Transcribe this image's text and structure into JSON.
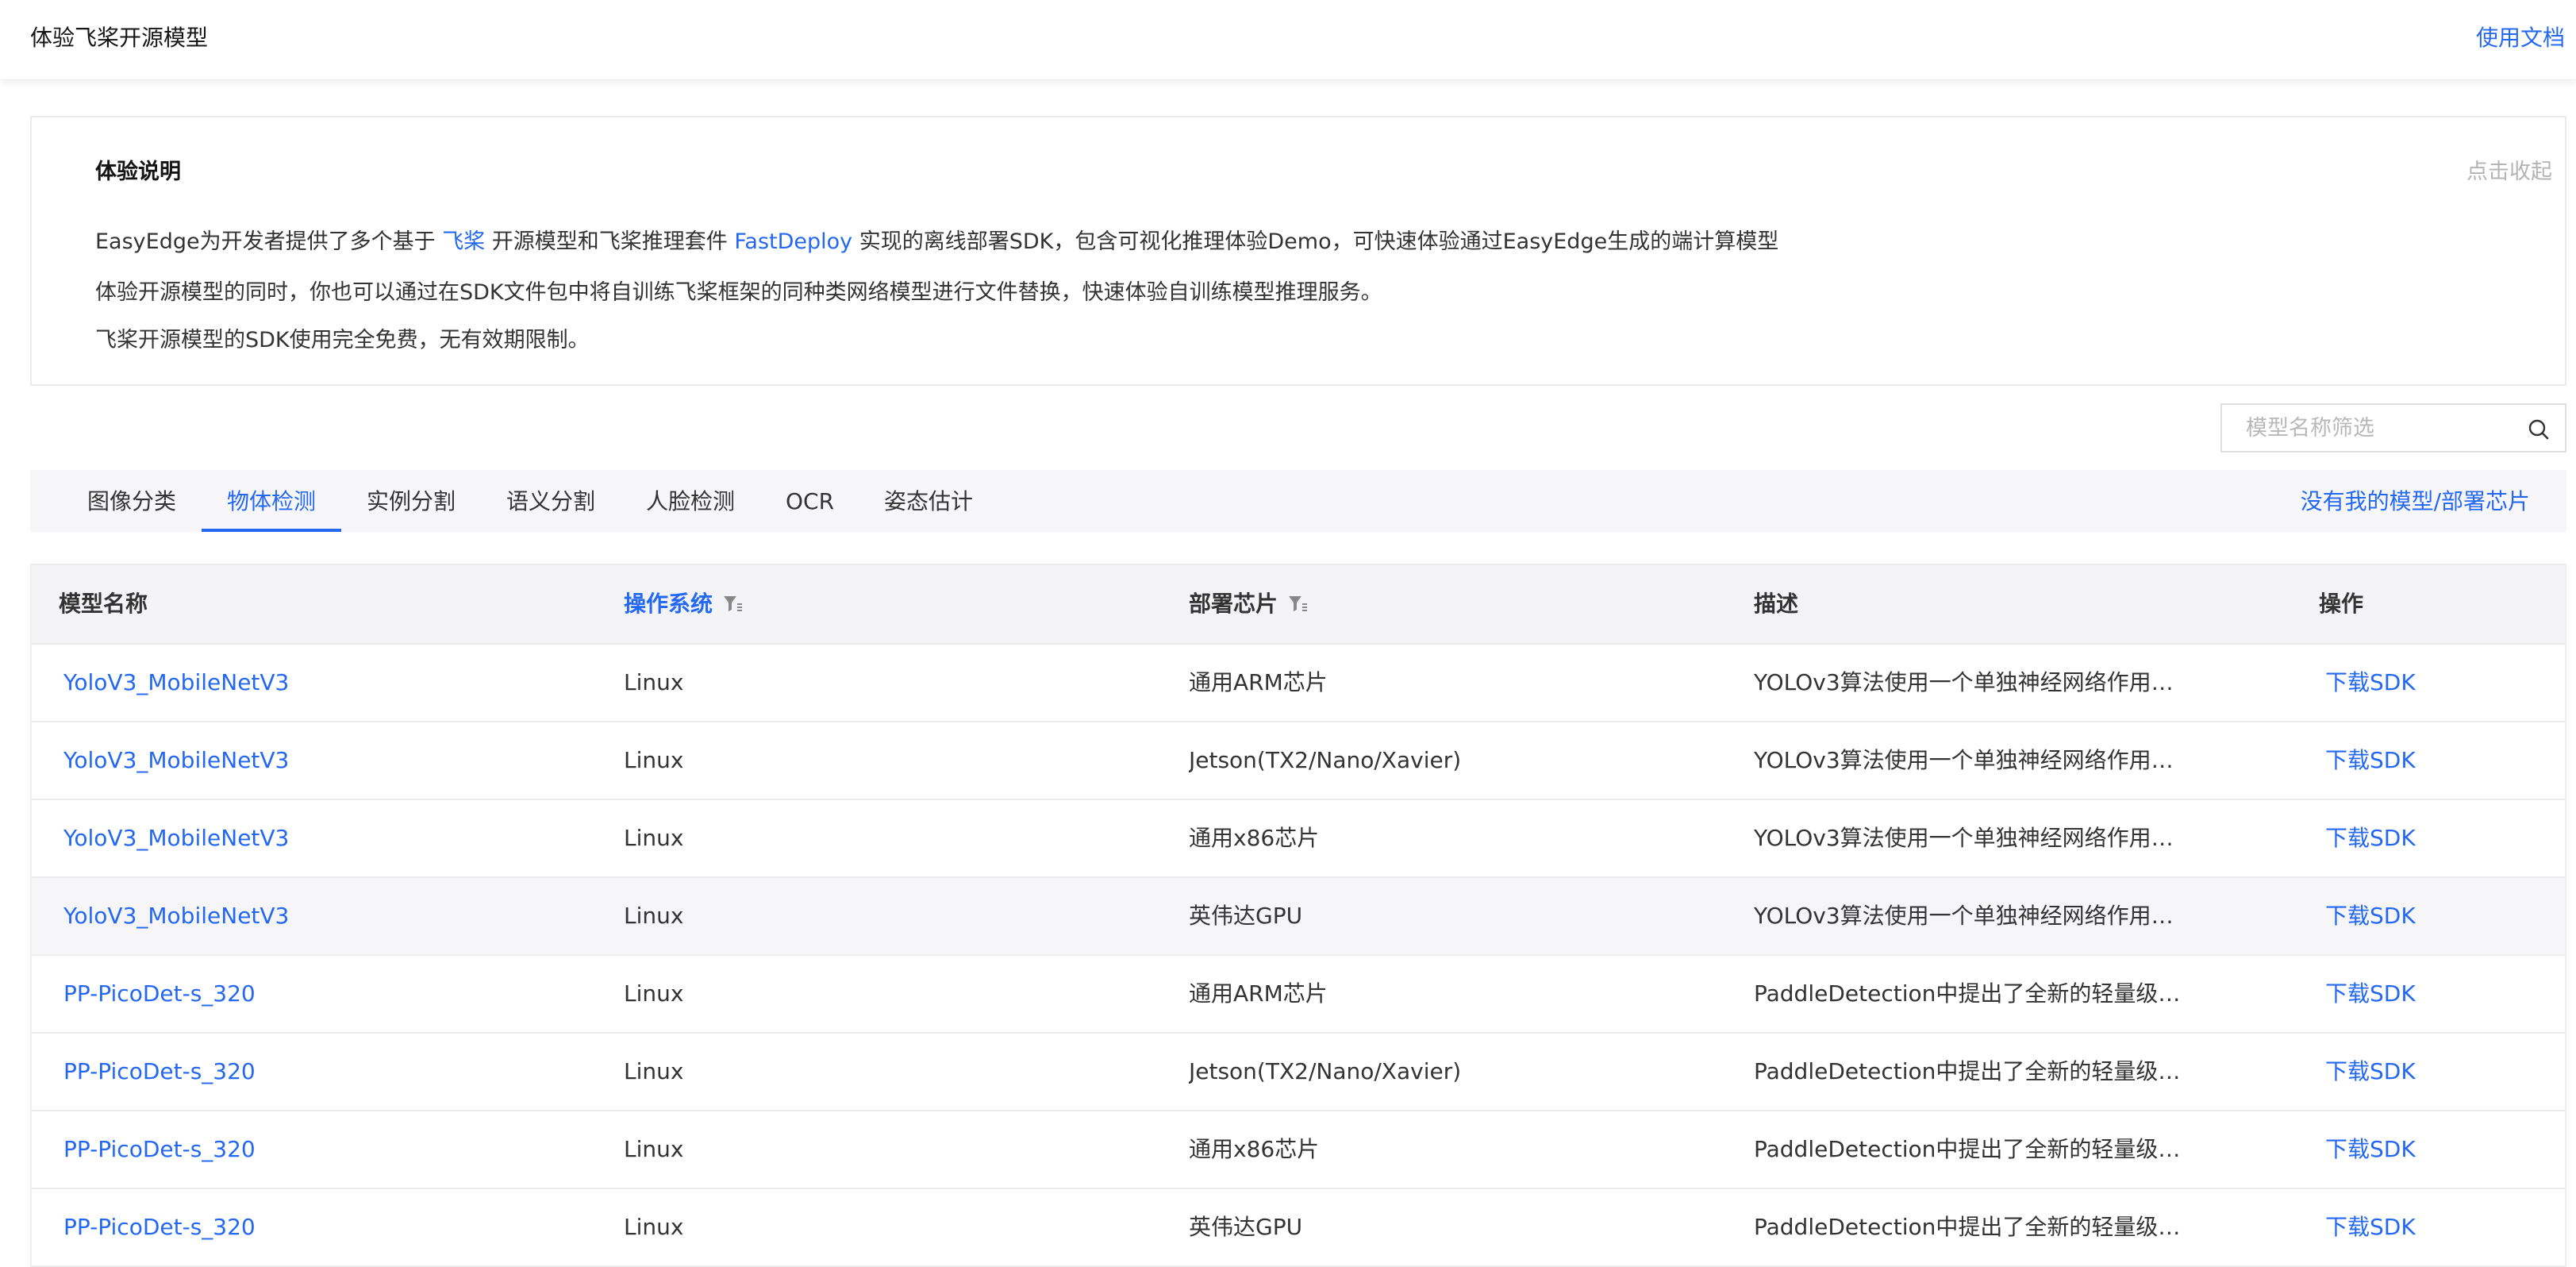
{
  "header": {
    "title": "体验飞桨开源模型",
    "doc_link": "使用文档"
  },
  "intro": {
    "title": "体验说明",
    "collapse": "点击收起",
    "line1_a": "EasyEdge为开发者提供了多个基于 ",
    "line1_link1": "飞桨",
    "line1_b": " 开源模型和飞桨推理套件 ",
    "line1_link2": "FastDeploy",
    "line1_c": " 实现的离线部署SDK，包含可视化推理体验Demo，可快速体验通过EasyEdge生成的端计算模型",
    "line2": "体验开源模型的同时，你也可以通过在SDK文件包中将自训练飞桨框架的同种类网络模型进行文件替换，快速体验自训练模型推理服务。",
    "line3": "飞桨开源模型的SDK使用完全免费，无有效期限制。"
  },
  "search": {
    "placeholder": "模型名称筛选",
    "value": ""
  },
  "tabs": [
    {
      "label": "图像分类"
    },
    {
      "label": "物体检测",
      "active": true
    },
    {
      "label": "实例分割"
    },
    {
      "label": "语义分割"
    },
    {
      "label": "人脸检测"
    },
    {
      "label": "OCR"
    },
    {
      "label": "姿态估计"
    }
  ],
  "no_model_link": "没有我的模型/部署芯片",
  "table": {
    "columns": [
      "模型名称",
      "操作系统",
      "部署芯片",
      "描述",
      "操作"
    ],
    "rows": [
      {
        "name": "YoloV3_MobileNetV3",
        "os": "Linux",
        "chip": "通用ARM芯片",
        "desc": "YOLOv3算法使用一个单独神经网络作用…",
        "op": "下载SDK"
      },
      {
        "name": "YoloV3_MobileNetV3",
        "os": "Linux",
        "chip": "Jetson(TX2/Nano/Xavier)",
        "desc": "YOLOv3算法使用一个单独神经网络作用…",
        "op": "下载SDK"
      },
      {
        "name": "YoloV3_MobileNetV3",
        "os": "Linux",
        "chip": "通用x86芯片",
        "desc": "YOLOv3算法使用一个单独神经网络作用…",
        "op": "下载SDK"
      },
      {
        "name": "YoloV3_MobileNetV3",
        "os": "Linux",
        "chip": "英伟达GPU",
        "desc": "YOLOv3算法使用一个单独神经网络作用…",
        "op": "下载SDK"
      },
      {
        "name": "PP-PicoDet-s_320",
        "os": "Linux",
        "chip": "通用ARM芯片",
        "desc": "PaddleDetection中提出了全新的轻量级…",
        "op": "下载SDK"
      },
      {
        "name": "PP-PicoDet-s_320",
        "os": "Linux",
        "chip": "Jetson(TX2/Nano/Xavier)",
        "desc": "PaddleDetection中提出了全新的轻量级…",
        "op": "下载SDK"
      },
      {
        "name": "PP-PicoDet-s_320",
        "os": "Linux",
        "chip": "通用x86芯片",
        "desc": "PaddleDetection中提出了全新的轻量级…",
        "op": "下载SDK"
      },
      {
        "name": "PP-PicoDet-s_320",
        "os": "Linux",
        "chip": "英伟达GPU",
        "desc": "PaddleDetection中提出了全新的轻量级…",
        "op": "下载SDK"
      }
    ]
  },
  "colors": {
    "accent": "#2468f2",
    "text": "#333333",
    "muted": "#b4b4b4",
    "header_bg": "#f4f4f6"
  }
}
